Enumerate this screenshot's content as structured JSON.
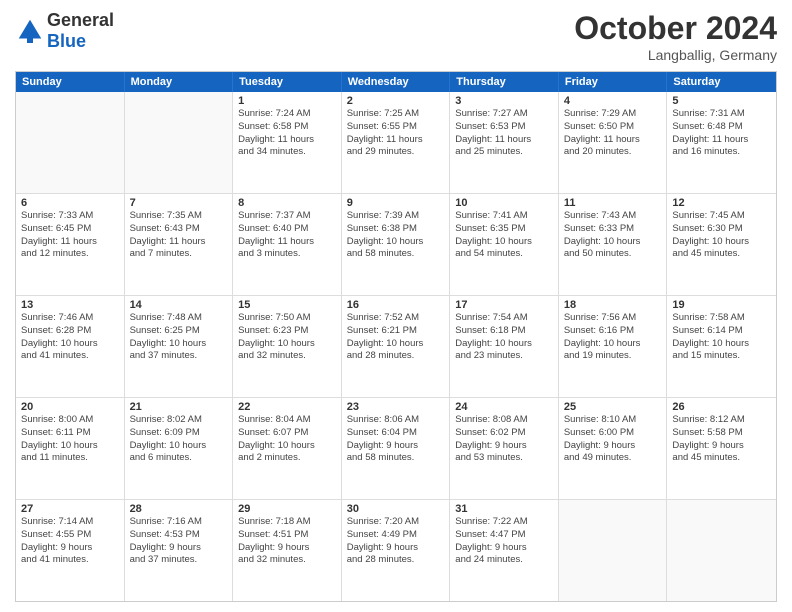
{
  "header": {
    "logo_general": "General",
    "logo_blue": "Blue",
    "month": "October 2024",
    "location": "Langballig, Germany"
  },
  "days_of_week": [
    "Sunday",
    "Monday",
    "Tuesday",
    "Wednesday",
    "Thursday",
    "Friday",
    "Saturday"
  ],
  "rows": [
    [
      {
        "day": "",
        "lines": [],
        "empty": true
      },
      {
        "day": "",
        "lines": [],
        "empty": true
      },
      {
        "day": "1",
        "lines": [
          "Sunrise: 7:24 AM",
          "Sunset: 6:58 PM",
          "Daylight: 11 hours",
          "and 34 minutes."
        ]
      },
      {
        "day": "2",
        "lines": [
          "Sunrise: 7:25 AM",
          "Sunset: 6:55 PM",
          "Daylight: 11 hours",
          "and 29 minutes."
        ]
      },
      {
        "day": "3",
        "lines": [
          "Sunrise: 7:27 AM",
          "Sunset: 6:53 PM",
          "Daylight: 11 hours",
          "and 25 minutes."
        ]
      },
      {
        "day": "4",
        "lines": [
          "Sunrise: 7:29 AM",
          "Sunset: 6:50 PM",
          "Daylight: 11 hours",
          "and 20 minutes."
        ]
      },
      {
        "day": "5",
        "lines": [
          "Sunrise: 7:31 AM",
          "Sunset: 6:48 PM",
          "Daylight: 11 hours",
          "and 16 minutes."
        ]
      }
    ],
    [
      {
        "day": "6",
        "lines": [
          "Sunrise: 7:33 AM",
          "Sunset: 6:45 PM",
          "Daylight: 11 hours",
          "and 12 minutes."
        ]
      },
      {
        "day": "7",
        "lines": [
          "Sunrise: 7:35 AM",
          "Sunset: 6:43 PM",
          "Daylight: 11 hours",
          "and 7 minutes."
        ]
      },
      {
        "day": "8",
        "lines": [
          "Sunrise: 7:37 AM",
          "Sunset: 6:40 PM",
          "Daylight: 11 hours",
          "and 3 minutes."
        ]
      },
      {
        "day": "9",
        "lines": [
          "Sunrise: 7:39 AM",
          "Sunset: 6:38 PM",
          "Daylight: 10 hours",
          "and 58 minutes."
        ]
      },
      {
        "day": "10",
        "lines": [
          "Sunrise: 7:41 AM",
          "Sunset: 6:35 PM",
          "Daylight: 10 hours",
          "and 54 minutes."
        ]
      },
      {
        "day": "11",
        "lines": [
          "Sunrise: 7:43 AM",
          "Sunset: 6:33 PM",
          "Daylight: 10 hours",
          "and 50 minutes."
        ]
      },
      {
        "day": "12",
        "lines": [
          "Sunrise: 7:45 AM",
          "Sunset: 6:30 PM",
          "Daylight: 10 hours",
          "and 45 minutes."
        ]
      }
    ],
    [
      {
        "day": "13",
        "lines": [
          "Sunrise: 7:46 AM",
          "Sunset: 6:28 PM",
          "Daylight: 10 hours",
          "and 41 minutes."
        ]
      },
      {
        "day": "14",
        "lines": [
          "Sunrise: 7:48 AM",
          "Sunset: 6:25 PM",
          "Daylight: 10 hours",
          "and 37 minutes."
        ]
      },
      {
        "day": "15",
        "lines": [
          "Sunrise: 7:50 AM",
          "Sunset: 6:23 PM",
          "Daylight: 10 hours",
          "and 32 minutes."
        ]
      },
      {
        "day": "16",
        "lines": [
          "Sunrise: 7:52 AM",
          "Sunset: 6:21 PM",
          "Daylight: 10 hours",
          "and 28 minutes."
        ]
      },
      {
        "day": "17",
        "lines": [
          "Sunrise: 7:54 AM",
          "Sunset: 6:18 PM",
          "Daylight: 10 hours",
          "and 23 minutes."
        ]
      },
      {
        "day": "18",
        "lines": [
          "Sunrise: 7:56 AM",
          "Sunset: 6:16 PM",
          "Daylight: 10 hours",
          "and 19 minutes."
        ]
      },
      {
        "day": "19",
        "lines": [
          "Sunrise: 7:58 AM",
          "Sunset: 6:14 PM",
          "Daylight: 10 hours",
          "and 15 minutes."
        ]
      }
    ],
    [
      {
        "day": "20",
        "lines": [
          "Sunrise: 8:00 AM",
          "Sunset: 6:11 PM",
          "Daylight: 10 hours",
          "and 11 minutes."
        ]
      },
      {
        "day": "21",
        "lines": [
          "Sunrise: 8:02 AM",
          "Sunset: 6:09 PM",
          "Daylight: 10 hours",
          "and 6 minutes."
        ]
      },
      {
        "day": "22",
        "lines": [
          "Sunrise: 8:04 AM",
          "Sunset: 6:07 PM",
          "Daylight: 10 hours",
          "and 2 minutes."
        ]
      },
      {
        "day": "23",
        "lines": [
          "Sunrise: 8:06 AM",
          "Sunset: 6:04 PM",
          "Daylight: 9 hours",
          "and 58 minutes."
        ]
      },
      {
        "day": "24",
        "lines": [
          "Sunrise: 8:08 AM",
          "Sunset: 6:02 PM",
          "Daylight: 9 hours",
          "and 53 minutes."
        ]
      },
      {
        "day": "25",
        "lines": [
          "Sunrise: 8:10 AM",
          "Sunset: 6:00 PM",
          "Daylight: 9 hours",
          "and 49 minutes."
        ]
      },
      {
        "day": "26",
        "lines": [
          "Sunrise: 8:12 AM",
          "Sunset: 5:58 PM",
          "Daylight: 9 hours",
          "and 45 minutes."
        ]
      }
    ],
    [
      {
        "day": "27",
        "lines": [
          "Sunrise: 7:14 AM",
          "Sunset: 4:55 PM",
          "Daylight: 9 hours",
          "and 41 minutes."
        ]
      },
      {
        "day": "28",
        "lines": [
          "Sunrise: 7:16 AM",
          "Sunset: 4:53 PM",
          "Daylight: 9 hours",
          "and 37 minutes."
        ]
      },
      {
        "day": "29",
        "lines": [
          "Sunrise: 7:18 AM",
          "Sunset: 4:51 PM",
          "Daylight: 9 hours",
          "and 32 minutes."
        ]
      },
      {
        "day": "30",
        "lines": [
          "Sunrise: 7:20 AM",
          "Sunset: 4:49 PM",
          "Daylight: 9 hours",
          "and 28 minutes."
        ]
      },
      {
        "day": "31",
        "lines": [
          "Sunrise: 7:22 AM",
          "Sunset: 4:47 PM",
          "Daylight: 9 hours",
          "and 24 minutes."
        ]
      },
      {
        "day": "",
        "lines": [],
        "empty": true
      },
      {
        "day": "",
        "lines": [],
        "empty": true
      }
    ]
  ]
}
